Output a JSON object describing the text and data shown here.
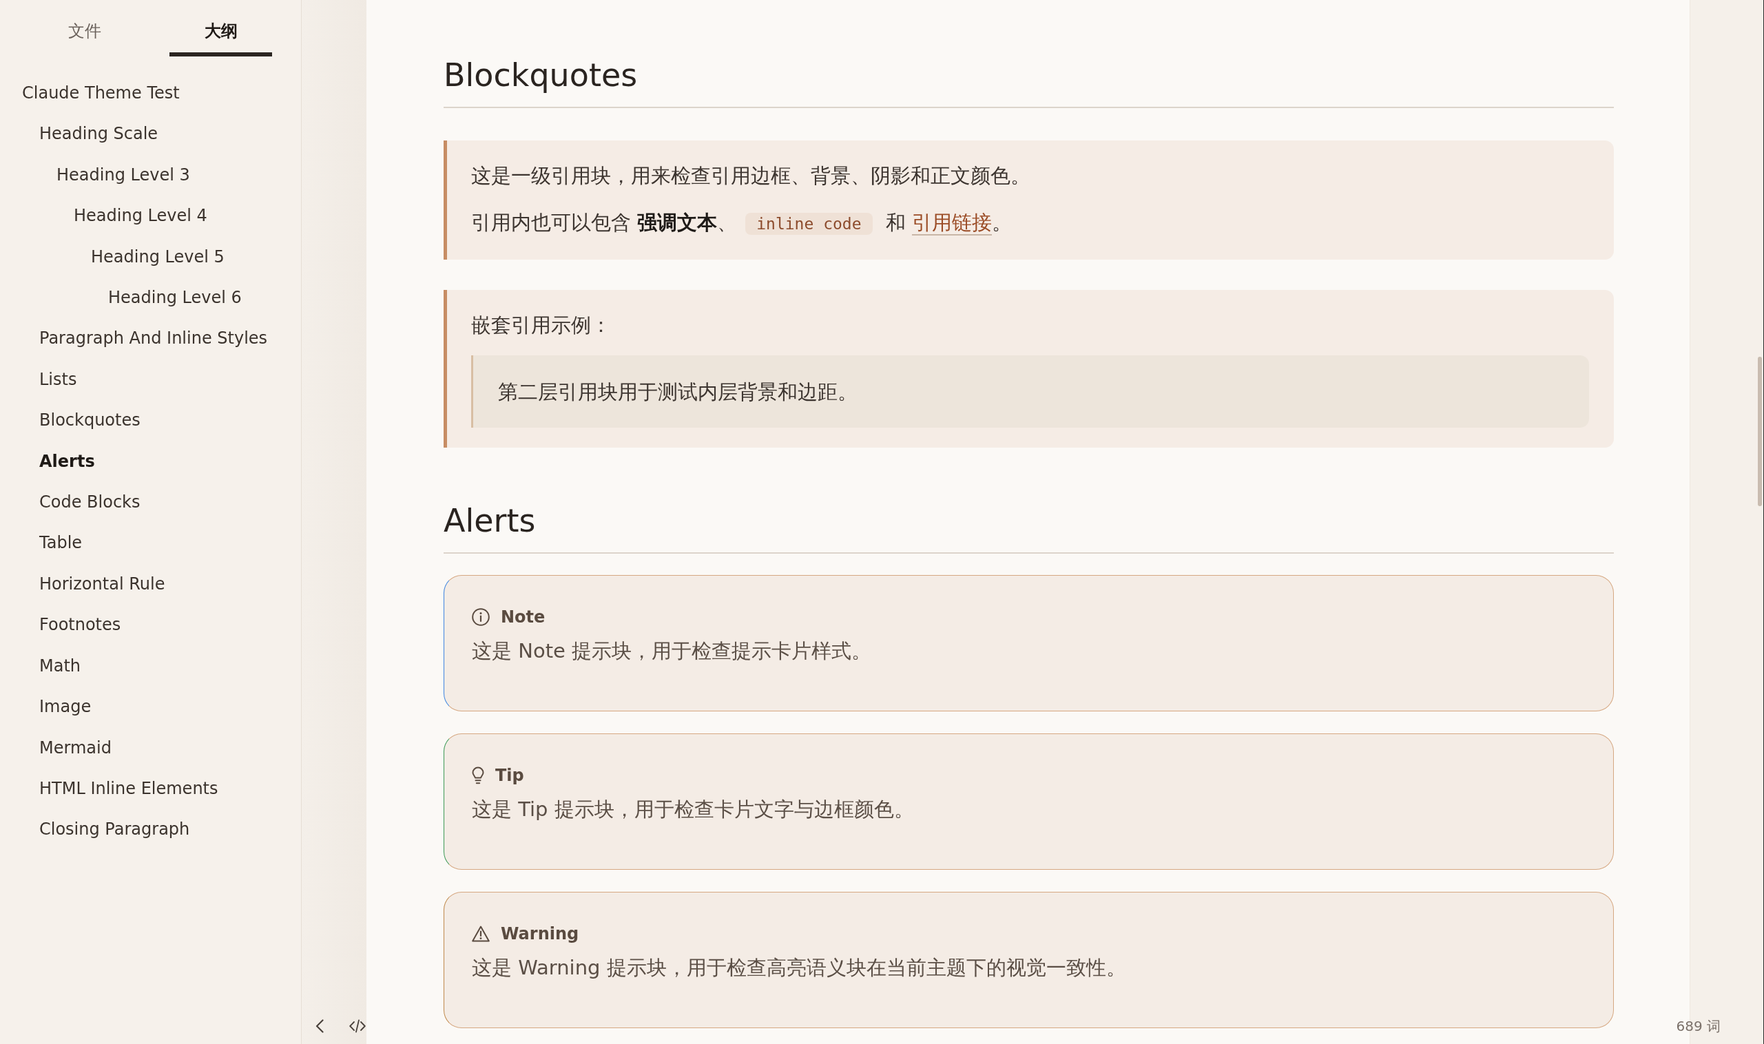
{
  "sidebar": {
    "tabs": [
      {
        "label": "文件",
        "selected": false
      },
      {
        "label": "大纲",
        "selected": true
      }
    ],
    "outline": [
      {
        "label": "Claude Theme Test",
        "selected": false,
        "children": [
          {
            "label": "Heading Scale",
            "selected": false,
            "children": [
              {
                "label": "Heading Level 3",
                "selected": false,
                "children": [
                  {
                    "label": "Heading Level 4",
                    "selected": false,
                    "children": [
                      {
                        "label": "Heading Level 5",
                        "selected": false,
                        "children": [
                          {
                            "label": "Heading Level 6",
                            "selected": false
                          }
                        ]
                      }
                    ]
                  }
                ]
              }
            ]
          },
          {
            "label": "Paragraph And Inline Styles",
            "selected": false
          },
          {
            "label": "Lists",
            "selected": false
          },
          {
            "label": "Blockquotes",
            "selected": false
          },
          {
            "label": "Alerts",
            "selected": true
          },
          {
            "label": "Code Blocks",
            "selected": false
          },
          {
            "label": "Table",
            "selected": false
          },
          {
            "label": "Horizontal Rule",
            "selected": false
          },
          {
            "label": "Footnotes",
            "selected": false
          },
          {
            "label": "Math",
            "selected": false
          },
          {
            "label": "Image",
            "selected": false
          },
          {
            "label": "Mermaid",
            "selected": false
          },
          {
            "label": "HTML Inline Elements",
            "selected": false
          },
          {
            "label": "Closing Paragraph",
            "selected": false
          }
        ]
      }
    ]
  },
  "document": {
    "sections": [
      {
        "heading": "Blockquotes",
        "blocks": [
          {
            "kind": "blockquote",
            "paragraphs": [
              {
                "runs": [
                  {
                    "kind": "text",
                    "text": "这是一级引用块，用来检查引用边框、背景、阴影和正文颜色。"
                  }
                ]
              },
              {
                "runs": [
                  {
                    "kind": "text",
                    "text": "引用内也可以包含 "
                  },
                  {
                    "kind": "strong",
                    "text": "强调文本"
                  },
                  {
                    "kind": "text",
                    "text": "、"
                  },
                  {
                    "kind": "code",
                    "text": "inline code"
                  },
                  {
                    "kind": "text",
                    "text": " 和 "
                  },
                  {
                    "kind": "link",
                    "text": "引用链接"
                  },
                  {
                    "kind": "text",
                    "text": "。"
                  }
                ]
              }
            ]
          },
          {
            "kind": "blockquote",
            "paragraphs": [
              {
                "runs": [
                  {
                    "kind": "text",
                    "text": "嵌套引用示例："
                  }
                ]
              }
            ],
            "nested": {
              "paragraphs": [
                {
                  "runs": [
                    {
                      "kind": "text",
                      "text": "第二层引用块用于测试内层背景和边距。"
                    }
                  ]
                }
              ]
            }
          }
        ]
      },
      {
        "heading": "Alerts",
        "blocks": [
          {
            "kind": "note",
            "title": "Note",
            "text": "这是 Note 提示块，用于检查提示卡片样式。"
          },
          {
            "kind": "tip",
            "title": "Tip",
            "text": "这是 Tip 提示块，用于检查卡片文字与边框颜色。"
          },
          {
            "kind": "warning",
            "title": "Warning",
            "text": "这是 Warning 提示块，用于检查高亮语义块在当前主题下的视觉一致性。"
          }
        ]
      }
    ]
  },
  "status_bar": {
    "word_count": "689 词"
  }
}
